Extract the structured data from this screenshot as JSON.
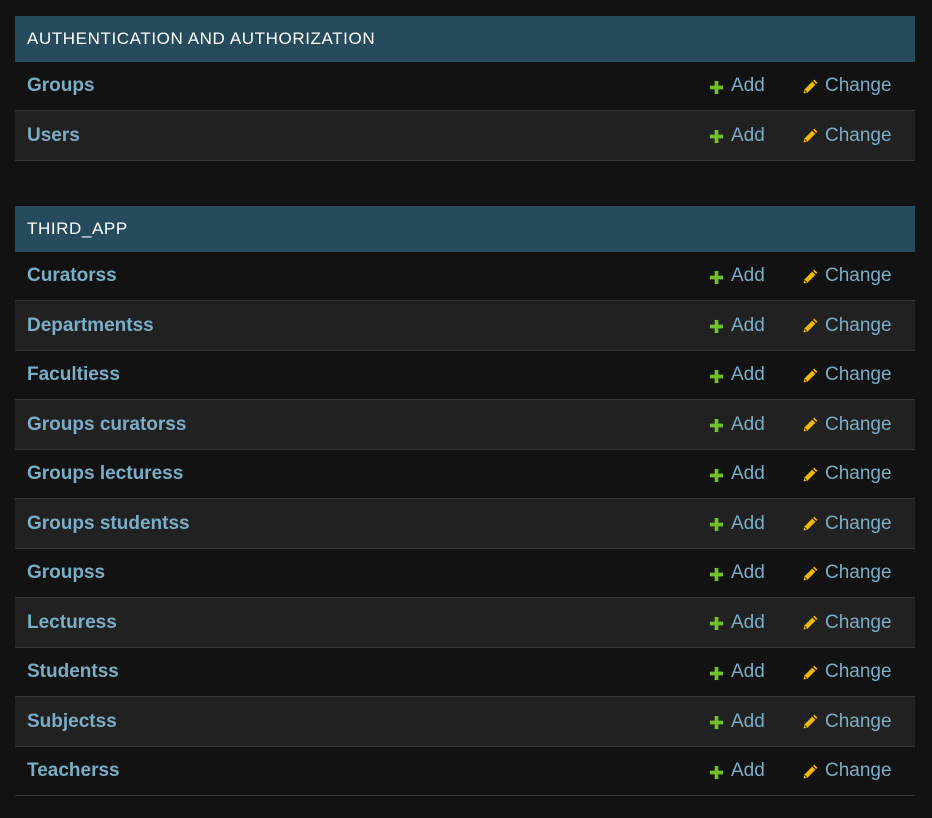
{
  "modules": [
    {
      "title": "AUTHENTICATION AND AUTHORIZATION",
      "models": [
        {
          "name": "Groups",
          "add": "Add",
          "change": "Change"
        },
        {
          "name": "Users",
          "add": "Add",
          "change": "Change"
        }
      ]
    },
    {
      "title": "THIRD_APP",
      "models": [
        {
          "name": "Curatorss",
          "add": "Add",
          "change": "Change"
        },
        {
          "name": "Departmentss",
          "add": "Add",
          "change": "Change"
        },
        {
          "name": "Facultiess",
          "add": "Add",
          "change": "Change"
        },
        {
          "name": "Groups curatorss",
          "add": "Add",
          "change": "Change"
        },
        {
          "name": "Groups lecturess",
          "add": "Add",
          "change": "Change"
        },
        {
          "name": "Groups studentss",
          "add": "Add",
          "change": "Change"
        },
        {
          "name": "Groupss",
          "add": "Add",
          "change": "Change"
        },
        {
          "name": "Lecturess",
          "add": "Add",
          "change": "Change"
        },
        {
          "name": "Studentss",
          "add": "Add",
          "change": "Change"
        },
        {
          "name": "Subjectss",
          "add": "Add",
          "change": "Change"
        },
        {
          "name": "Teacherss",
          "add": "Add",
          "change": "Change"
        }
      ]
    }
  ],
  "colors": {
    "header_bg": "#264b5d",
    "link": "#79aec8",
    "add_icon": "#70bf2b",
    "change_icon": "#efb80b"
  }
}
